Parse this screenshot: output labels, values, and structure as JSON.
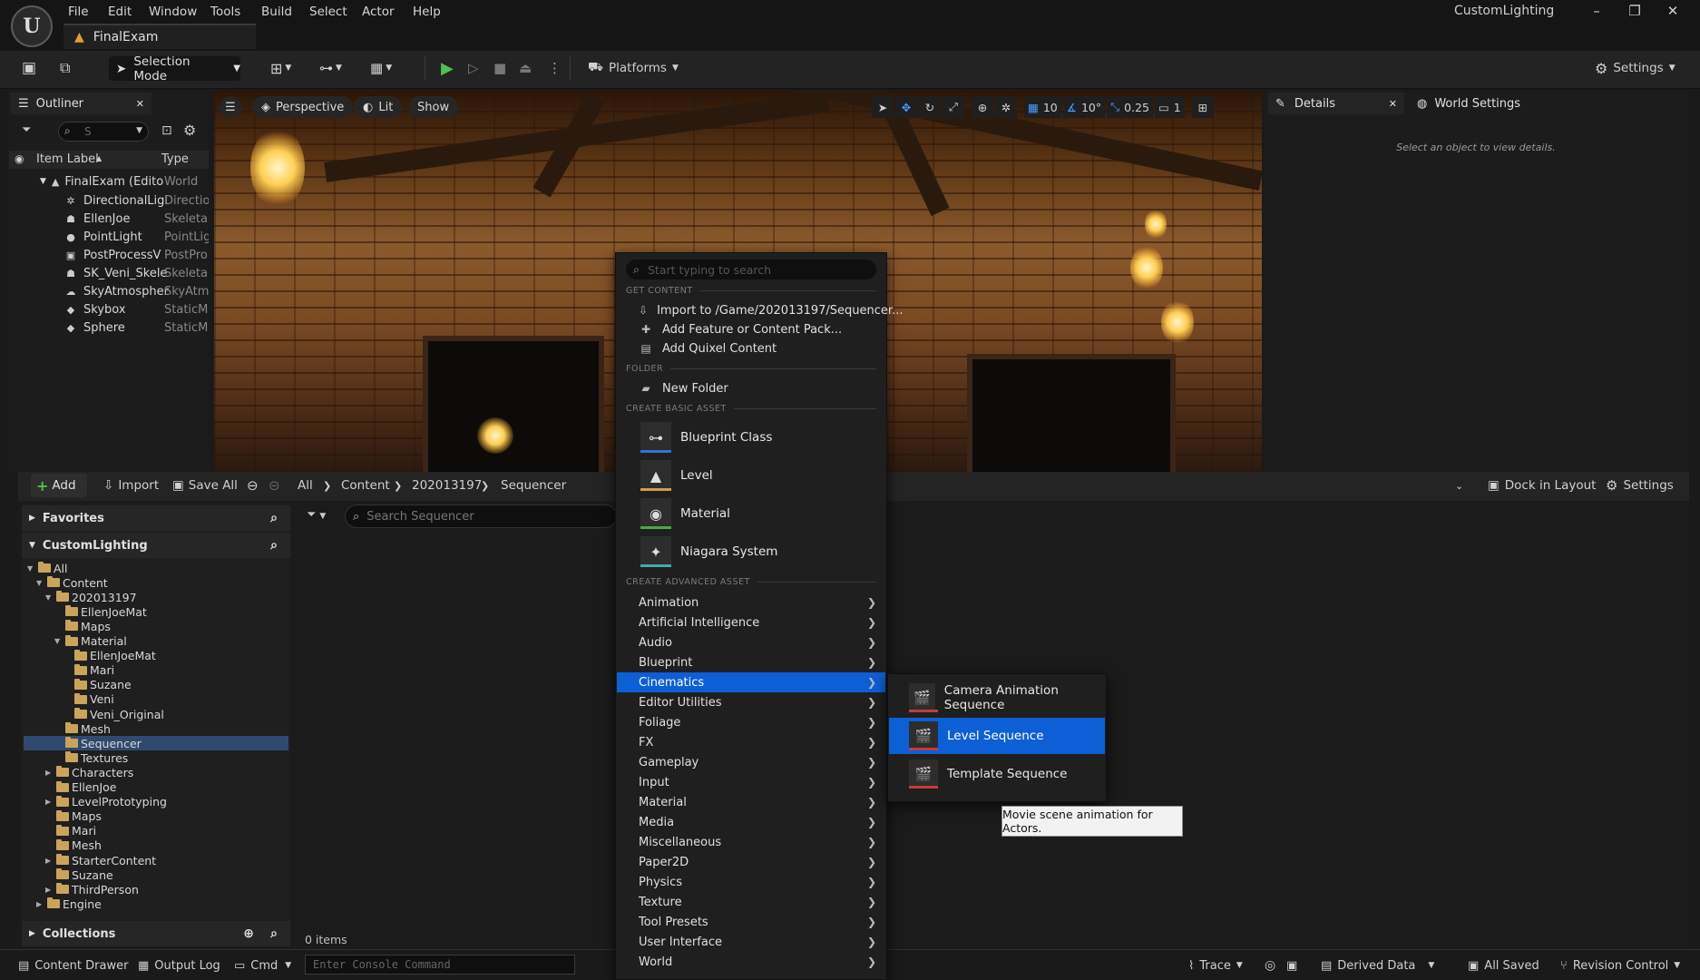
{
  "app": {
    "logo_text": "U",
    "window_title": "CustomLighting",
    "project_tab": "FinalExam",
    "menus": [
      "File",
      "Edit",
      "Window",
      "Tools",
      "Build",
      "Select",
      "Actor",
      "Help"
    ],
    "window_buttons": {
      "minimize": "–",
      "maximize": "❐",
      "close": "✕"
    }
  },
  "toolbar": {
    "selection_mode": "Selection Mode",
    "platforms": "Platforms",
    "settings": "Settings"
  },
  "outliner": {
    "tab_label": "Outliner",
    "search_value": "S",
    "col_label": "Item Label",
    "col_type": "Type",
    "root": {
      "label": "FinalExam (Edito",
      "type": "World"
    },
    "items": [
      {
        "label": "DirectionalLigl",
        "type": "Directio",
        "icon": "directional-light-icon"
      },
      {
        "label": "EllenJoe",
        "type": "Skeletal",
        "icon": "skeletal-mesh-icon"
      },
      {
        "label": "PointLight",
        "type": "PointLig",
        "icon": "point-light-icon"
      },
      {
        "label": "PostProcessV",
        "type": "PostPro",
        "icon": "postprocess-icon"
      },
      {
        "label": "SK_Veni_Skele",
        "type": "Skeletal",
        "icon": "skeletal-mesh-icon"
      },
      {
        "label": "SkyAtmospher",
        "type": "SkyAtm",
        "icon": "sky-atmosphere-icon"
      },
      {
        "label": "Skybox",
        "type": "StaticMe",
        "icon": "static-mesh-icon"
      },
      {
        "label": "Sphere",
        "type": "StaticMe",
        "icon": "static-mesh-icon"
      }
    ]
  },
  "viewport": {
    "perspective": "Perspective",
    "lit": "Lit",
    "show": "Show",
    "grid_snap": "10",
    "rot_snap": "10°",
    "scale_snap": "0.25",
    "camera_speed": "1"
  },
  "details": {
    "tab_details": "Details",
    "tab_world": "World Settings",
    "hint": "Select an object to view details."
  },
  "content_browser": {
    "add": "Add",
    "import": "Import",
    "save_all": "Save All",
    "breadcrumbs": [
      "All",
      "Content",
      "202013197",
      "Sequencer"
    ],
    "dock": "Dock in Layout",
    "settings": "Settings",
    "favorites": "Favorites",
    "project": "CustomLighting",
    "collections": "Collections",
    "search_placeholder": "Search Sequencer",
    "item_count": "0 items",
    "tree": [
      {
        "label": "All",
        "indent": 0,
        "arrow": "▼"
      },
      {
        "label": "Content",
        "indent": 1,
        "arrow": "▼"
      },
      {
        "label": "202013197",
        "indent": 2,
        "arrow": "▼"
      },
      {
        "label": "EllenJoeMat",
        "indent": 3,
        "arrow": ""
      },
      {
        "label": "Maps",
        "indent": 3,
        "arrow": ""
      },
      {
        "label": "Material",
        "indent": 3,
        "arrow": "▼"
      },
      {
        "label": "EllenJoeMat",
        "indent": 4,
        "arrow": ""
      },
      {
        "label": "Mari",
        "indent": 4,
        "arrow": ""
      },
      {
        "label": "Suzane",
        "indent": 4,
        "arrow": ""
      },
      {
        "label": "Veni",
        "indent": 4,
        "arrow": ""
      },
      {
        "label": "Veni_Original",
        "indent": 4,
        "arrow": ""
      },
      {
        "label": "Mesh",
        "indent": 3,
        "arrow": ""
      },
      {
        "label": "Sequencer",
        "indent": 3,
        "arrow": "",
        "selected": true
      },
      {
        "label": "Textures",
        "indent": 3,
        "arrow": ""
      },
      {
        "label": "Characters",
        "indent": 2,
        "arrow": "▶"
      },
      {
        "label": "EllenJoe",
        "indent": 2,
        "arrow": ""
      },
      {
        "label": "LevelPrototyping",
        "indent": 2,
        "arrow": "▶"
      },
      {
        "label": "Maps",
        "indent": 2,
        "arrow": ""
      },
      {
        "label": "Mari",
        "indent": 2,
        "arrow": ""
      },
      {
        "label": "Mesh",
        "indent": 2,
        "arrow": ""
      },
      {
        "label": "StarterContent",
        "indent": 2,
        "arrow": "▶"
      },
      {
        "label": "Suzane",
        "indent": 2,
        "arrow": ""
      },
      {
        "label": "ThirdPerson",
        "indent": 2,
        "arrow": "▶"
      },
      {
        "label": "Engine",
        "indent": 1,
        "arrow": "▶"
      }
    ]
  },
  "context_menu": {
    "search_placeholder": "Start typing to search",
    "head_get_content": "GET CONTENT",
    "import_to": "Import to /Game/202013197/Sequencer...",
    "add_feature": "Add Feature or Content Pack...",
    "add_quixel": "Add Quixel Content",
    "head_folder": "FOLDER",
    "new_folder": "New Folder",
    "head_basic": "CREATE BASIC ASSET",
    "basic_assets": [
      {
        "label": "Blueprint Class",
        "icon": "blueprint-class-icon",
        "accent": "#3a6fd8"
      },
      {
        "label": "Level",
        "icon": "level-icon",
        "accent": "#d0a040"
      },
      {
        "label": "Material",
        "icon": "material-icon",
        "accent": "#4aa84a"
      },
      {
        "label": "Niagara System",
        "icon": "niagara-system-icon",
        "accent": "#3ab0b0"
      }
    ],
    "head_advanced": "CREATE ADVANCED ASSET",
    "advanced": [
      "Animation",
      "Artificial Intelligence",
      "Audio",
      "Blueprint",
      "Cinematics",
      "Editor Utilities",
      "Foliage",
      "FX",
      "Gameplay",
      "Input",
      "Material",
      "Media",
      "Miscellaneous",
      "Paper2D",
      "Physics",
      "Texture",
      "Tool Presets",
      "User Interface",
      "World"
    ],
    "selected_advanced": "Cinematics"
  },
  "submenu": {
    "items": [
      "Camera Animation Sequence",
      "Level Sequence",
      "Template Sequence"
    ],
    "selected": "Level Sequence",
    "tooltip": "Movie scene animation for Actors."
  },
  "statusbar": {
    "content_drawer": "Content Drawer",
    "output_log": "Output Log",
    "cmd": "Cmd",
    "console_placeholder": "Enter Console Command",
    "trace": "Trace",
    "derived_data": "Derived Data",
    "all_saved": "All Saved",
    "revision_control": "Revision Control"
  },
  "colors": {
    "accent": "#0d5fd6",
    "play": "#4ec14e"
  }
}
